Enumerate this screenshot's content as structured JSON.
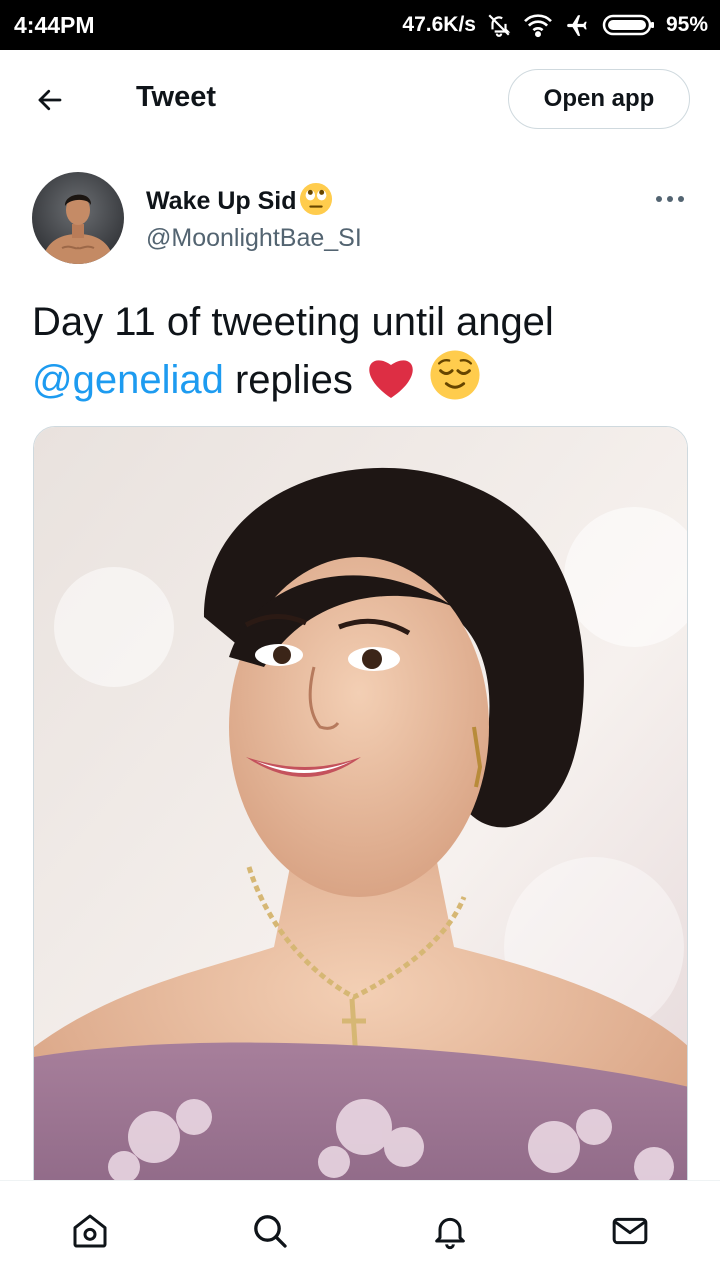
{
  "status_bar": {
    "time": "4:44PM",
    "network_speed": "47.6K/s",
    "battery": "95%",
    "icons": [
      "bell-off-icon",
      "wifi-icon",
      "airplane-mode-icon",
      "battery-icon"
    ]
  },
  "header": {
    "title": "Tweet",
    "back_icon": "arrow-left-icon",
    "open_app_label": "Open app"
  },
  "tweet": {
    "display_name": "Wake Up Sid",
    "display_name_emoji": "face-with-rolling-eyes",
    "handle": "@MoonlightBae_SI",
    "text_before": "Day 11 of tweeting until angel",
    "mention": "@geneliad",
    "text_after": "replies",
    "text_emojis": [
      "red-heart",
      "relieved-face"
    ],
    "more_icon": "more-horizontal-icon"
  },
  "colors": {
    "accent": "#1d9bf0",
    "text_primary": "#0f1419",
    "text_secondary": "#536471",
    "border": "#cfd9de"
  },
  "bottom_nav": {
    "items": [
      "home-icon",
      "search-icon",
      "notifications-icon",
      "messages-icon"
    ]
  }
}
